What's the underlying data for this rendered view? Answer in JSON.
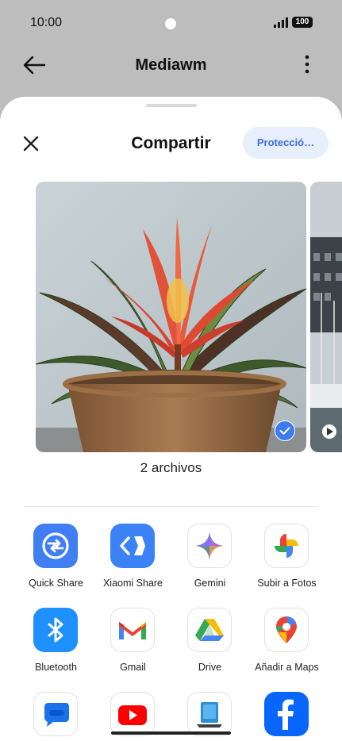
{
  "status_bar": {
    "time": "10:00",
    "battery": "100"
  },
  "app_header": {
    "title": "Mediawm"
  },
  "share_sheet": {
    "title": "Compartir",
    "protection_button": "Protecció…",
    "file_count": "2 archivos"
  },
  "apps": [
    {
      "label": "Quick Share",
      "icon": "quick-share-icon"
    },
    {
      "label": "Xiaomi Share",
      "icon": "xiaomi-share-icon"
    },
    {
      "label": "Gemini",
      "icon": "gemini-icon"
    },
    {
      "label": "Subir a Fotos",
      "icon": "google-photos-icon"
    },
    {
      "label": "Bluetooth",
      "icon": "bluetooth-icon"
    },
    {
      "label": "Gmail",
      "icon": "gmail-icon"
    },
    {
      "label": "Drive",
      "icon": "drive-icon"
    },
    {
      "label": "Añadir a Maps",
      "icon": "maps-icon"
    },
    {
      "label": "",
      "icon": "messages-icon"
    },
    {
      "label": "",
      "icon": "youtube-icon"
    },
    {
      "label": "",
      "icon": "laptop-icon"
    },
    {
      "label": "",
      "icon": "facebook-icon"
    }
  ],
  "colors": {
    "accent": "#3d7bf0",
    "protect_button_bg": "#e7eefc",
    "header_bg": "#bdbdbd"
  }
}
